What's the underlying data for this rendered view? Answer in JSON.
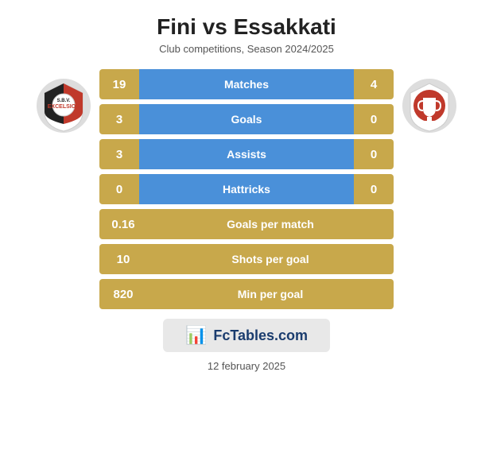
{
  "header": {
    "title": "Fini vs Essakkati",
    "subtitle": "Club competitions, Season 2024/2025"
  },
  "stats": [
    {
      "label": "Matches",
      "left": "19",
      "right": "4",
      "type": "two-sided"
    },
    {
      "label": "Goals",
      "left": "3",
      "right": "0",
      "type": "two-sided"
    },
    {
      "label": "Assists",
      "left": "3",
      "right": "0",
      "type": "two-sided"
    },
    {
      "label": "Hattricks",
      "left": "0",
      "right": "0",
      "type": "two-sided"
    },
    {
      "label": "Goals per match",
      "left": "0.16",
      "type": "single"
    },
    {
      "label": "Shots per goal",
      "left": "10",
      "type": "single"
    },
    {
      "label": "Min per goal",
      "left": "820",
      "type": "single"
    }
  ],
  "watermark": {
    "text": "FcTables.com",
    "icon": "📊"
  },
  "date": "12 february 2025"
}
